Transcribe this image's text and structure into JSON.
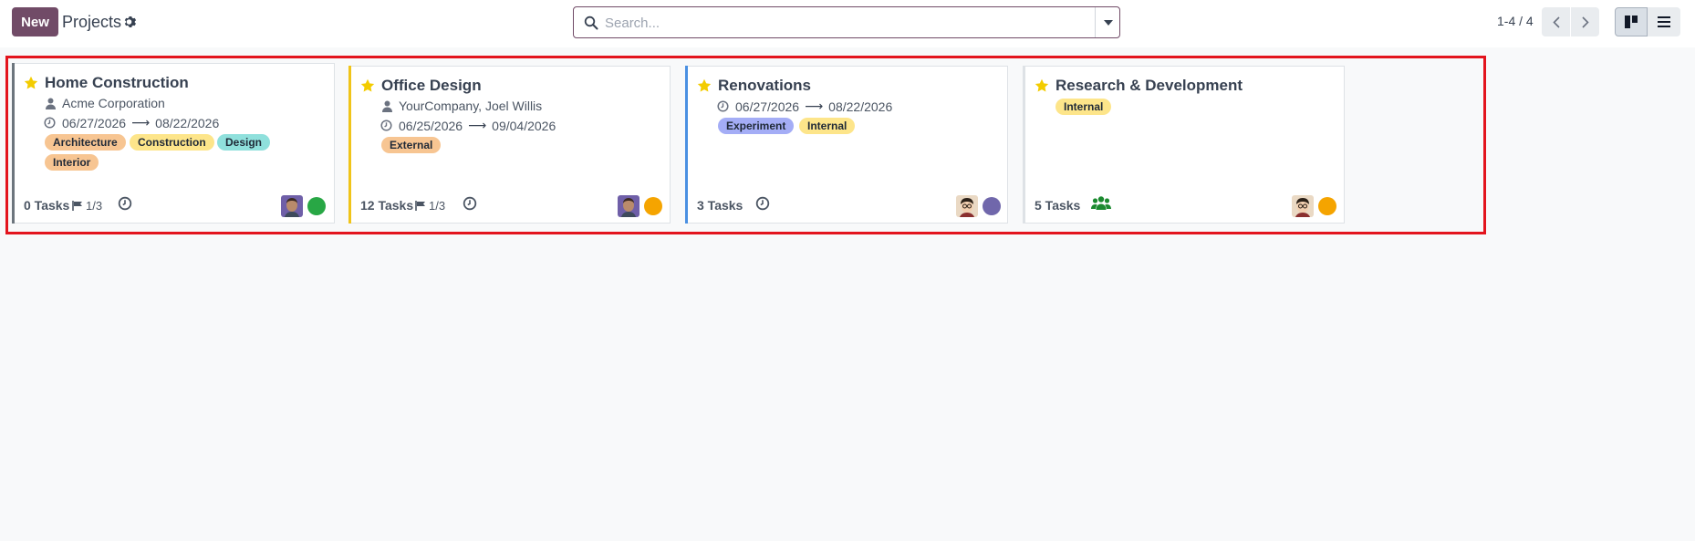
{
  "toolbar": {
    "new_label": "New",
    "title": "Projects",
    "search_placeholder": "Search...",
    "pager": "1-4 / 4",
    "brand_color": "#714b67"
  },
  "projects": [
    {
      "title": "Home Construction",
      "customer": "Acme Corporation",
      "date_start": "06/27/2026",
      "date_end": "08/22/2026",
      "arrow": "⟶",
      "tags": [
        {
          "label": "Architecture",
          "color": "#f7c592"
        },
        {
          "label": "Construction",
          "color": "#fde58a"
        },
        {
          "label": "Design",
          "color": "#8fe0dc"
        },
        {
          "label": "Interior",
          "color": "#f7c592"
        }
      ],
      "tasks": "0 Tasks",
      "milestones": "1/3",
      "accent": "#6c757d",
      "status_color": "#28a745",
      "favorite": true
    },
    {
      "title": "Office Design",
      "customer": "YourCompany, Joel Willis",
      "date_start": "06/25/2026",
      "date_end": "09/04/2026",
      "arrow": "⟶",
      "tags": [
        {
          "label": "External",
          "color": "#f7c592"
        }
      ],
      "tasks": "12 Tasks",
      "milestones": "1/3",
      "accent": "#f0c419",
      "status_color": "#f5a400",
      "favorite": true
    },
    {
      "title": "Renovations",
      "date_start": "06/27/2026",
      "date_end": "08/22/2026",
      "arrow": "⟶",
      "tags": [
        {
          "label": "Experiment",
          "color": "#a4adf6"
        },
        {
          "label": "Internal",
          "color": "#fde58a"
        }
      ],
      "tasks": "3 Tasks",
      "accent": "#4a90e2",
      "status_color": "#7067ab",
      "favorite": true
    },
    {
      "title": "Research & Development",
      "tags": [
        {
          "label": "Internal",
          "color": "#fde58a"
        }
      ],
      "tasks": "5 Tasks",
      "accent": "#dee2e6",
      "status_color": "#f5a400",
      "favorite": true
    }
  ],
  "icons": {
    "star": "star-icon",
    "user": "user-icon",
    "clock": "clock-icon",
    "flag": "flag-icon",
    "group": "users-group-icon"
  }
}
